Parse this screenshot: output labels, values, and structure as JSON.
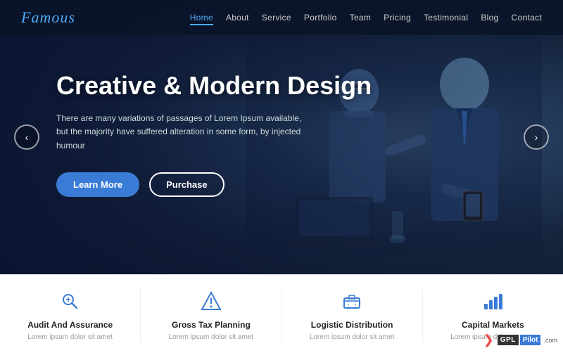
{
  "brand": {
    "name": "Famous"
  },
  "navbar": {
    "links": [
      {
        "label": "Home",
        "active": true
      },
      {
        "label": "About",
        "active": false
      },
      {
        "label": "Service",
        "active": false
      },
      {
        "label": "Portfolio",
        "active": false
      },
      {
        "label": "Team",
        "active": false
      },
      {
        "label": "Pricing",
        "active": false
      },
      {
        "label": "Testimonial",
        "active": false
      },
      {
        "label": "Blog",
        "active": false
      },
      {
        "label": "Contact",
        "active": false
      }
    ]
  },
  "hero": {
    "title": "Creative & Modern Design",
    "description": "There are many variations of passages of Lorem Ipsum available, but the majority have suffered alteration in some form, by injected humour",
    "btn_primary": "Learn More",
    "btn_secondary": "Purchase"
  },
  "services": [
    {
      "icon": "✦",
      "title": "Audit And Assurance",
      "description": "Lorem ipsum dolor sit amet"
    },
    {
      "icon": "🏛",
      "title": "Gross Tax Planning",
      "description": "Lorem ipsum dolor sit amet"
    },
    {
      "icon": "🧳",
      "title": "Logistic Distribution",
      "description": "Lorem ipsum dolor sit amet"
    },
    {
      "icon": "📊",
      "title": "Capital Markets",
      "description": "Lorem ipsum dolor sit amet"
    }
  ],
  "watermark": {
    "gpl": "GPL",
    "pilot": "Pilot",
    "com": ".com"
  }
}
